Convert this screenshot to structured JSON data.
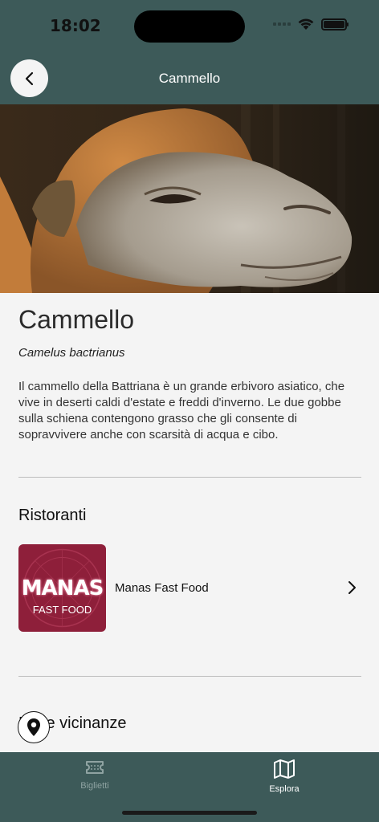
{
  "status": {
    "time": "18:02"
  },
  "header": {
    "title": "Cammello",
    "back_icon": "chevron-left-icon"
  },
  "animal": {
    "name": "Cammello",
    "scientific_name": "Camelus bactrianus",
    "description": "Il cammello della Battriana è un grande erbivoro asiatico, che vive in deserti caldi d'estate e freddi d'inverno. Le due gobbe sulla schiena contengono grasso che gli consente di sopravvivere anche con scarsità di acqua e cibo."
  },
  "restaurants": {
    "title": "Ristoranti",
    "items": [
      {
        "name": "Manas Fast Food",
        "logo_big": "MANAS",
        "logo_small": "FAST FOOD"
      }
    ]
  },
  "nearby": {
    "title": "Nelle vicinanze"
  },
  "tabs": [
    {
      "label": "Biglietti",
      "icon": "ticket-icon",
      "active": false
    },
    {
      "label": "Esplora",
      "icon": "map-icon",
      "active": true
    }
  ],
  "colors": {
    "brand": "#3d5a59",
    "logo_bg": "#8e1f3a",
    "background": "#f4f4f4"
  }
}
